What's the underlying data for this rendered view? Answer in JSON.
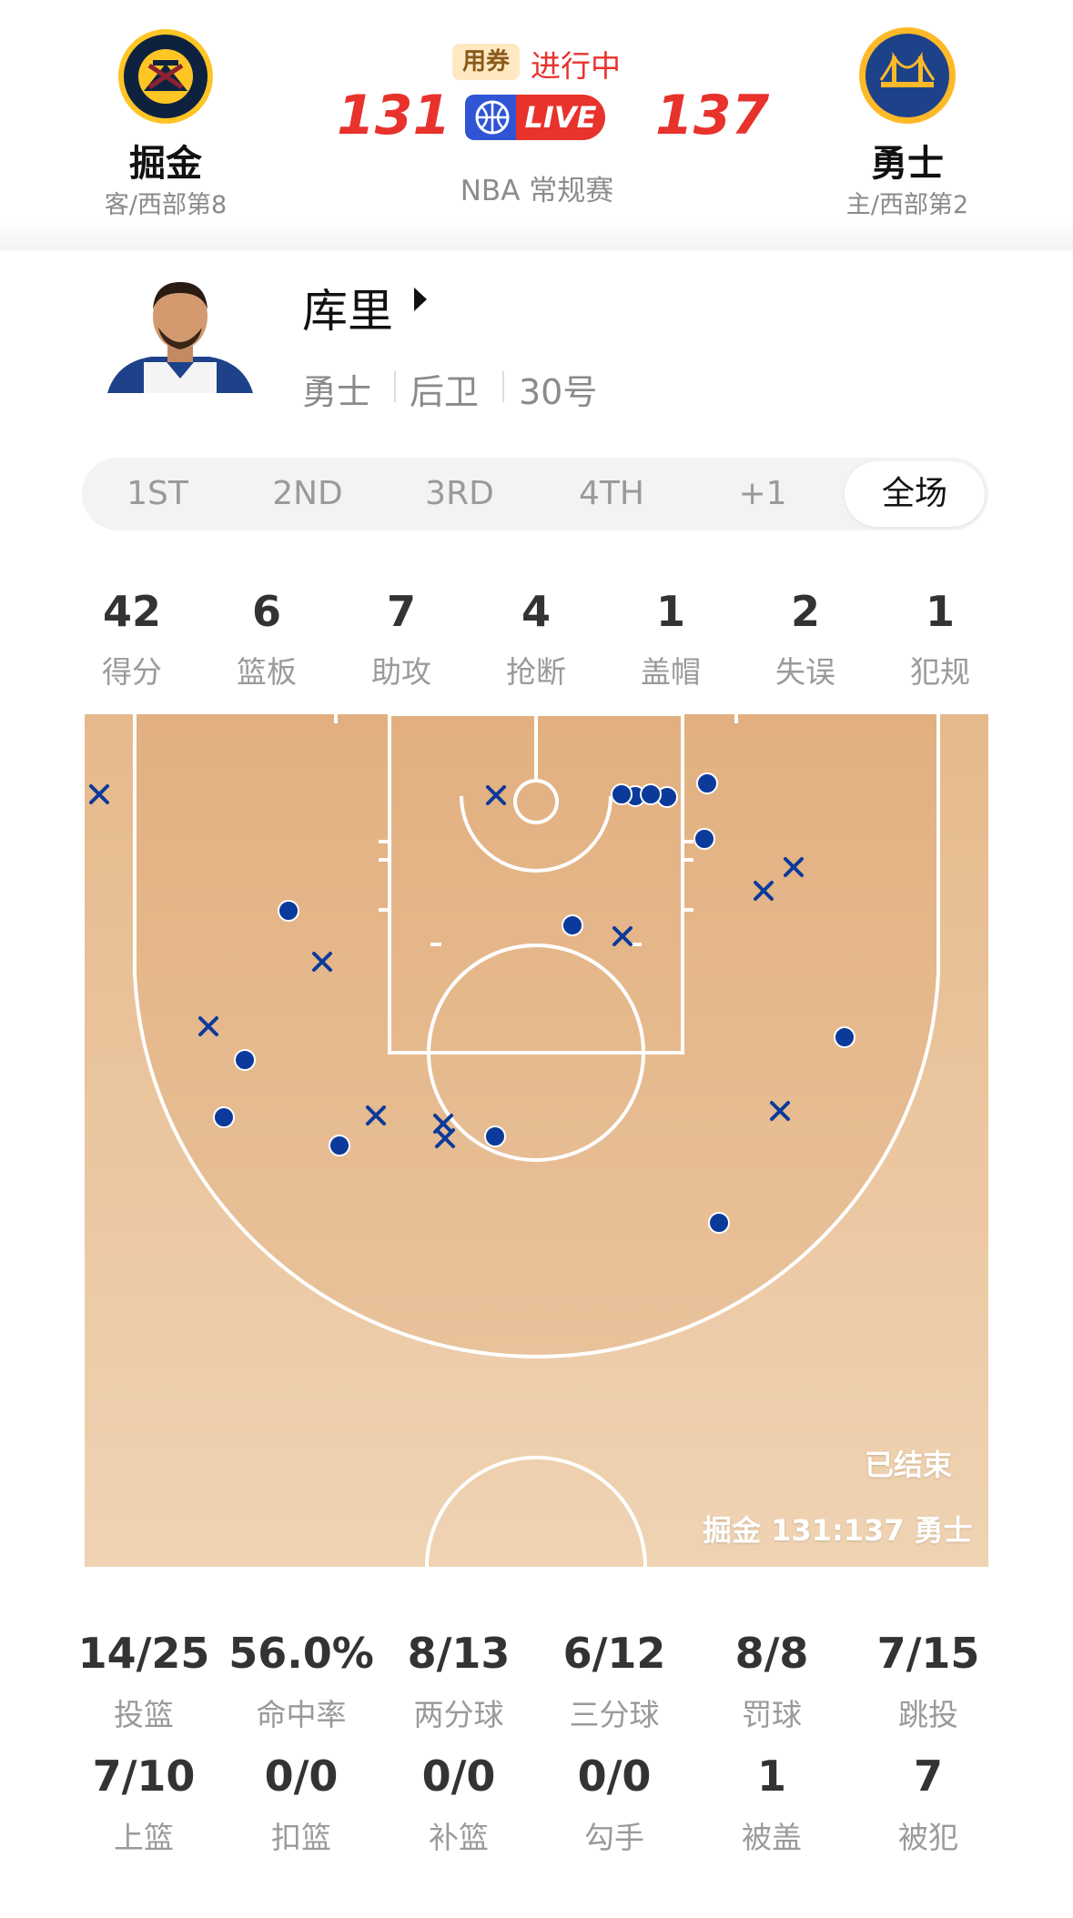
{
  "game": {
    "away_team": {
      "name": "掘金",
      "sub": "客/西部第8",
      "score": "131",
      "logo": "nuggets-logo"
    },
    "home_team": {
      "name": "勇士",
      "sub": "主/西部第2",
      "score": "137",
      "logo": "warriors-logo"
    },
    "coupon": "用券",
    "status": "进行中",
    "live_label": "LIVE",
    "league": "NBA 常规赛"
  },
  "player": {
    "name": "库里",
    "team": "勇士",
    "position": "后卫",
    "number": "30号"
  },
  "tabs": [
    {
      "label": "1ST",
      "active": false
    },
    {
      "label": "2ND",
      "active": false
    },
    {
      "label": "3RD",
      "active": false
    },
    {
      "label": "4TH",
      "active": false
    },
    {
      "label": "+1",
      "active": false
    },
    {
      "label": "全场",
      "active": true
    }
  ],
  "stats": [
    {
      "value": "42",
      "label": "得分"
    },
    {
      "value": "6",
      "label": "篮板"
    },
    {
      "value": "7",
      "label": "助攻"
    },
    {
      "value": "4",
      "label": "抢断"
    },
    {
      "value": "1",
      "label": "盖帽"
    },
    {
      "value": "2",
      "label": "失误"
    },
    {
      "value": "1",
      "label": "犯规"
    }
  ],
  "court": {
    "ended_label": "已结束",
    "score_line": "掘金 131:137 勇士",
    "make_color": "#0b3a9a",
    "miss_color": "#0b3a9a",
    "shots_made": 14,
    "shots_missed": 11
  },
  "shooting": [
    {
      "value": "14/25",
      "label": "投篮"
    },
    {
      "value": "56.0%",
      "label": "命中率"
    },
    {
      "value": "8/13",
      "label": "两分球"
    },
    {
      "value": "6/12",
      "label": "三分球"
    },
    {
      "value": "8/8",
      "label": "罚球"
    },
    {
      "value": "7/15",
      "label": "跳投"
    },
    {
      "value": "7/10",
      "label": "上篮"
    },
    {
      "value": "0/0",
      "label": "扣篮"
    },
    {
      "value": "0/0",
      "label": "补篮"
    },
    {
      "value": "0/0",
      "label": "勾手"
    },
    {
      "value": "1",
      "label": "被盖"
    },
    {
      "value": "7",
      "label": "被犯"
    }
  ]
}
